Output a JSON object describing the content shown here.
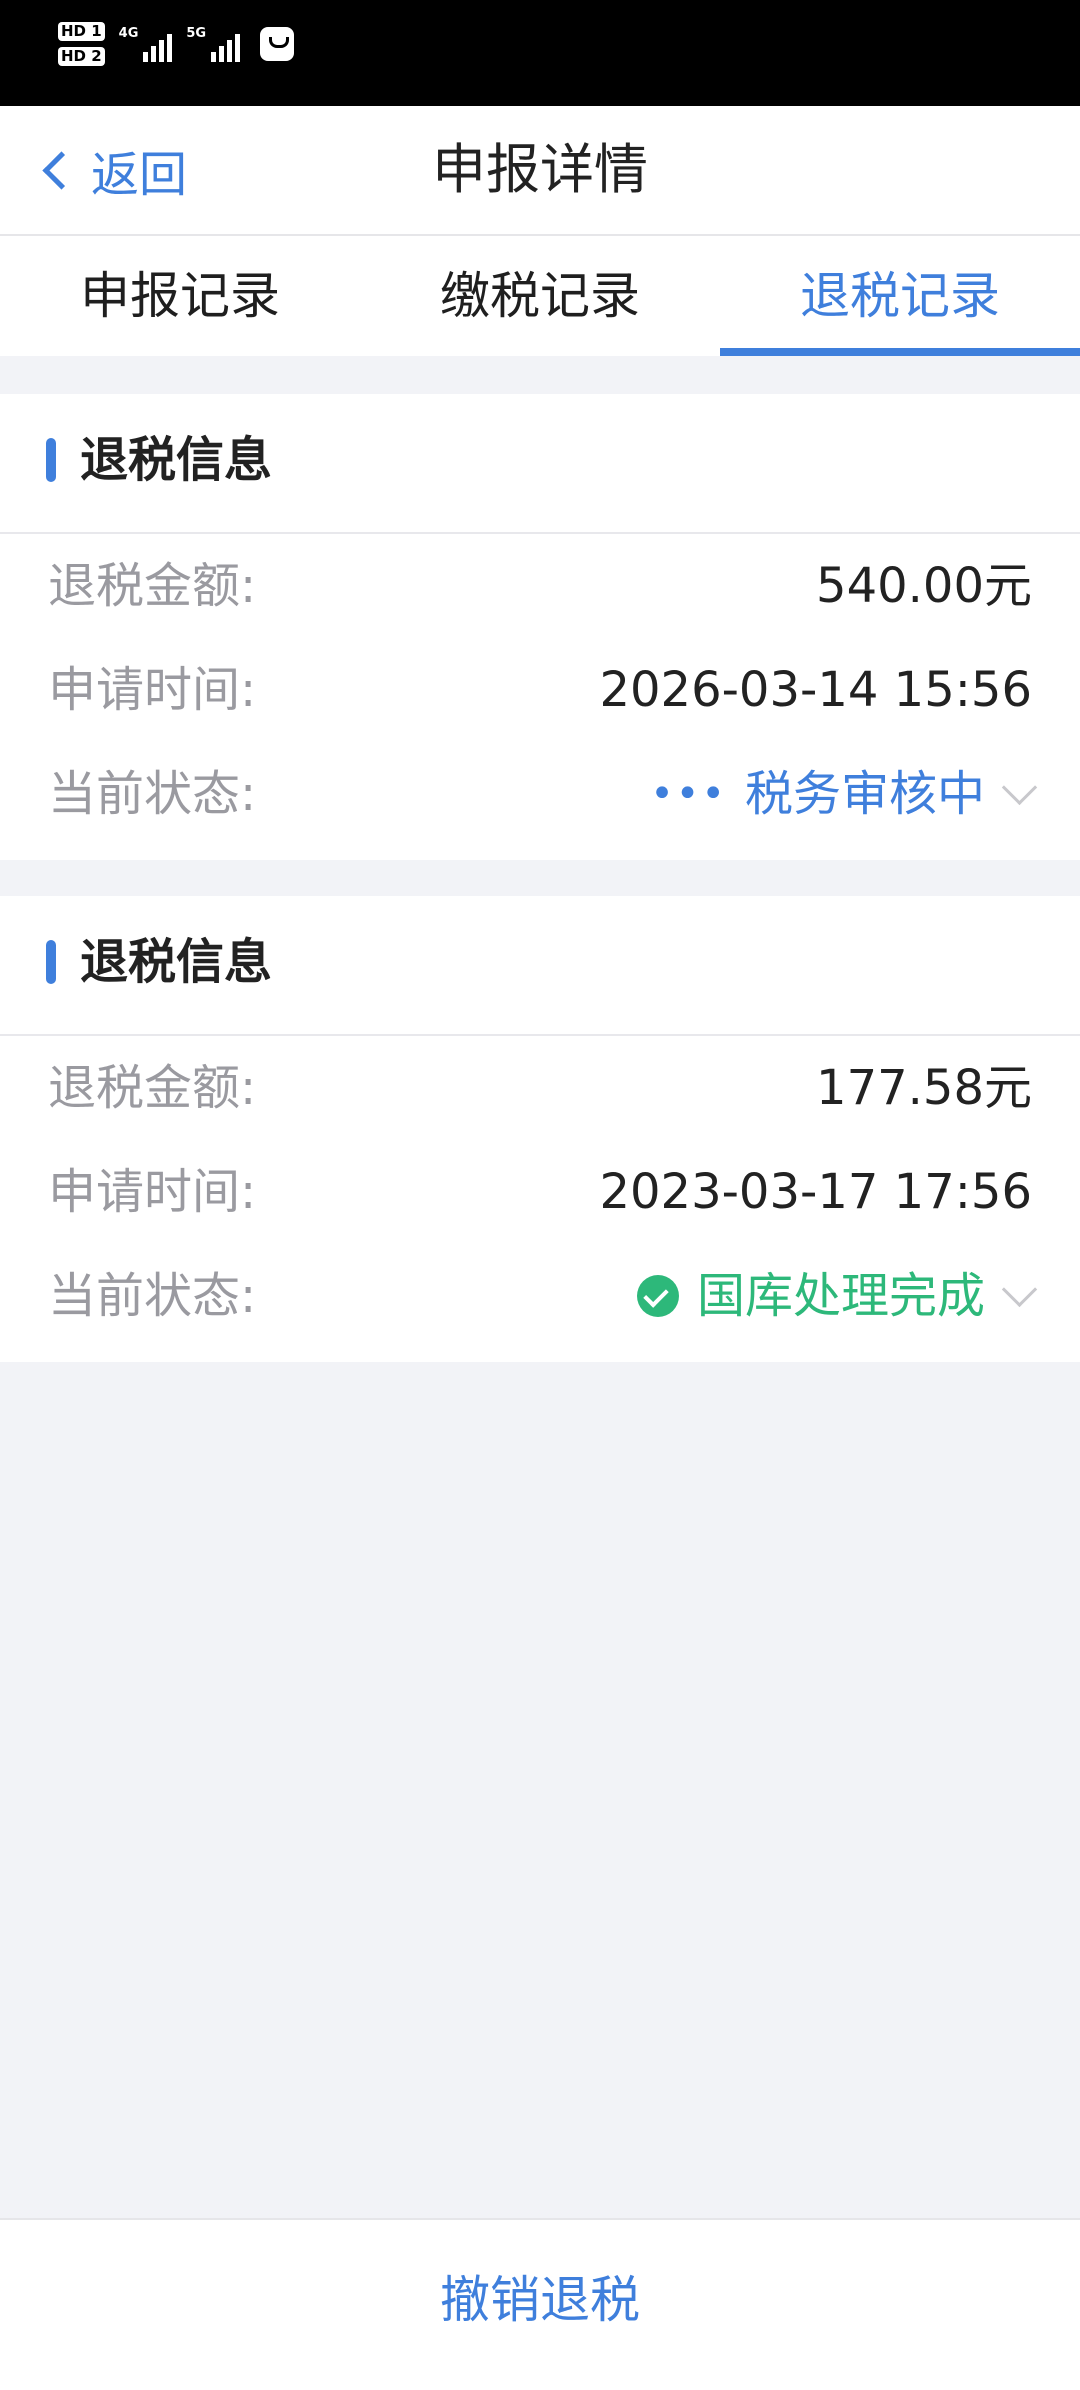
{
  "status_bar": {
    "sim1": "HD 1",
    "sim2": "HD 2",
    "net1": "4G",
    "net2": "5G",
    "icons": [
      "signal-icon",
      "signal-icon",
      "notification-icon"
    ]
  },
  "nav": {
    "back_label": "返回",
    "title": "申报详情"
  },
  "tabs": [
    {
      "label": "申报记录",
      "active": false
    },
    {
      "label": "缴税记录",
      "active": false
    },
    {
      "label": "退税记录",
      "active": true
    }
  ],
  "records": [
    {
      "section_title": "退税信息",
      "amount_label": "退税金额:",
      "amount": "540.00元",
      "time_label": "申请时间:",
      "time": "2026-03-14 15:56",
      "status_label": "当前状态:",
      "status": "税务审核中",
      "status_color": "#3f7fdc"
    },
    {
      "section_title": "退税信息",
      "amount_label": "退税金额:",
      "amount": "177.58元",
      "time_label": "申请时间:",
      "time": "2023-03-17 17:56",
      "status_label": "当前状态:",
      "status": "国库处理完成",
      "status_color": "#2db87a"
    }
  ],
  "bottom": {
    "action_label": "撤销退税"
  },
  "colors": {
    "accent": "#3f7fdc",
    "success": "#2db87a",
    "background": "#f2f3f7"
  }
}
